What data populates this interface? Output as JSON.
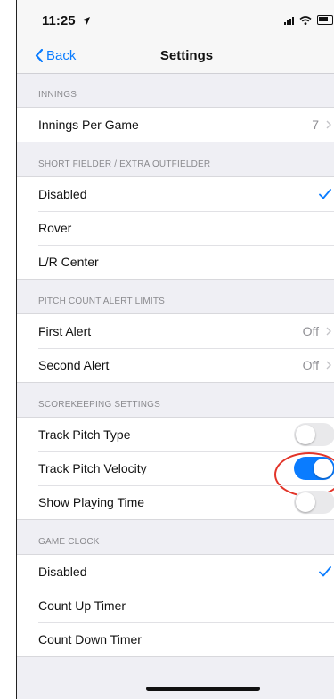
{
  "status": {
    "time": "11:25"
  },
  "nav": {
    "back_label": "Back",
    "title": "Settings"
  },
  "sections": [
    {
      "header": "INNINGS",
      "rows": [
        {
          "label": "Innings Per Game",
          "value": "7",
          "accessory": "chevron"
        }
      ]
    },
    {
      "header": "SHORT FIELDER / EXTRA OUTFIELDER",
      "rows": [
        {
          "label": "Disabled",
          "accessory": "check"
        },
        {
          "label": "Rover"
        },
        {
          "label": "L/R Center"
        }
      ]
    },
    {
      "header": "PITCH COUNT ALERT LIMITS",
      "rows": [
        {
          "label": "First Alert",
          "value": "Off",
          "accessory": "chevron"
        },
        {
          "label": "Second Alert",
          "value": "Off",
          "accessory": "chevron"
        }
      ]
    },
    {
      "header": "SCOREKEEPING SETTINGS",
      "rows": [
        {
          "label": "Track Pitch Type",
          "toggle": false
        },
        {
          "label": "Track Pitch Velocity",
          "toggle": true,
          "highlighted": true
        },
        {
          "label": "Show Playing Time",
          "toggle": false
        }
      ]
    },
    {
      "header": "GAME CLOCK",
      "rows": [
        {
          "label": "Disabled",
          "accessory": "check"
        },
        {
          "label": "Count Up Timer"
        },
        {
          "label": "Count Down Timer"
        }
      ]
    }
  ],
  "colors": {
    "accent": "#0a7cff",
    "highlight": "#e2352a",
    "toggle_off": "#e9e9eb"
  },
  "icons": {
    "back": "chevron-left-icon",
    "check": "checkmark-icon",
    "disclosure": "chevron-right-icon"
  }
}
